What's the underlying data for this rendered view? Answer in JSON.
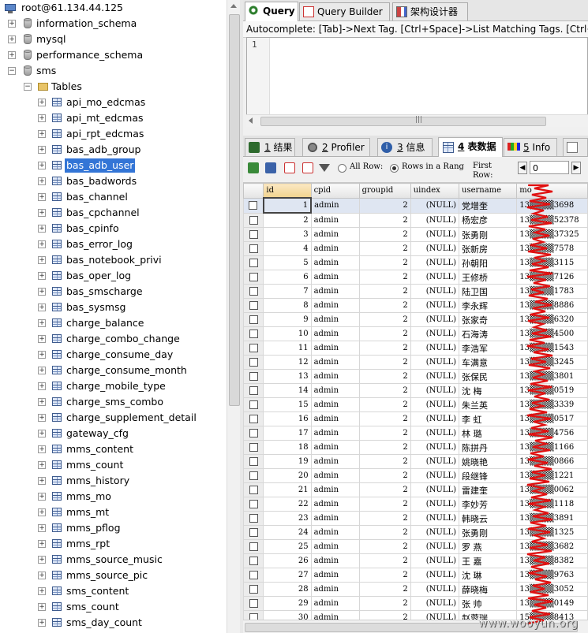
{
  "tree": {
    "connection": "root@61.134.44.125",
    "databases": [
      {
        "name": "information_schema",
        "expanded": false
      },
      {
        "name": "mysql",
        "expanded": false
      },
      {
        "name": "performance_schema",
        "expanded": false
      },
      {
        "name": "sms",
        "expanded": true
      }
    ],
    "tables_folder": "Tables",
    "tables": [
      "api_mo_edcmas",
      "api_mt_edcmas",
      "api_rpt_edcmas",
      "bas_adb_group",
      "bas_adb_user",
      "bas_badwords",
      "bas_channel",
      "bas_cpchannel",
      "bas_cpinfo",
      "bas_error_log",
      "bas_notebook_privi",
      "bas_oper_log",
      "bas_smscharge",
      "bas_sysmsg",
      "charge_balance",
      "charge_combo_change",
      "charge_consume_day",
      "charge_consume_month",
      "charge_mobile_type",
      "charge_sms_combo",
      "charge_supplement_detail",
      "gateway_cfg",
      "mms_content",
      "mms_count",
      "mms_history",
      "mms_mo",
      "mms_mt",
      "mms_pflog",
      "mms_rpt",
      "mms_source_music",
      "mms_source_pic",
      "sms_content",
      "sms_count",
      "sms_day_count"
    ],
    "selected_table": "bas_adb_user"
  },
  "top_tabs": [
    {
      "label": "Query",
      "active": true,
      "icon": "query-icon"
    },
    {
      "label": "Query Builder",
      "active": false,
      "icon": "query-builder-icon"
    },
    {
      "label": "架构设计器",
      "active": false,
      "icon": "schema-designer-icon"
    }
  ],
  "autocomplete": "Autocomplete: [Tab]->Next Tag. [Ctrl+Space]->List Matching Tags. [Ctrl+E",
  "editor": {
    "line_number": "1"
  },
  "bottom_tabs": [
    {
      "num": "1",
      "label": "结果",
      "icon": "result-icon"
    },
    {
      "num": "2",
      "label": "Profiler",
      "icon": "profiler-icon"
    },
    {
      "num": "3",
      "label": "信息",
      "icon": "info-icon"
    },
    {
      "num": "4",
      "label": "表数据",
      "icon": "table-data-icon",
      "active": true
    },
    {
      "num": "5",
      "label": "Info",
      "icon": "info2-icon"
    }
  ],
  "toolbar": {
    "all_row": "All Row:",
    "rows_in_range": "Rows in a Rang",
    "first_row_label_1": "First",
    "first_row_label_2": "Row:",
    "first_row_value": "0"
  },
  "grid": {
    "columns": [
      "id",
      "cpid",
      "groupid",
      "uindex",
      "username",
      "mo"
    ],
    "rows": [
      [
        "1",
        "admin",
        "2",
        "(NULL)",
        "党增奎",
        "13▒▒▒▒3698"
      ],
      [
        "2",
        "admin",
        "2",
        "(NULL)",
        "杨宏彦",
        "13▒▒▒▒52378"
      ],
      [
        "3",
        "admin",
        "2",
        "(NULL)",
        "张勇刚",
        "13▒▒▒▒37325"
      ],
      [
        "4",
        "admin",
        "2",
        "(NULL)",
        "张新房",
        "13▒▒▒▒7578"
      ],
      [
        "5",
        "admin",
        "2",
        "(NULL)",
        "孙朝阳",
        "13▒▒▒▒3115"
      ],
      [
        "6",
        "admin",
        "2",
        "(NULL)",
        "王修桥",
        "13▒▒▒▒7126"
      ],
      [
        "7",
        "admin",
        "2",
        "(NULL)",
        "陆卫国",
        "13▒▒▒▒1783"
      ],
      [
        "8",
        "admin",
        "2",
        "(NULL)",
        "李永辉",
        "13▒▒▒▒8886"
      ],
      [
        "9",
        "admin",
        "2",
        "(NULL)",
        "张家奇",
        "13▒▒▒▒6320"
      ],
      [
        "10",
        "admin",
        "2",
        "(NULL)",
        "石海涛",
        "13▒▒▒▒4500"
      ],
      [
        "11",
        "admin",
        "2",
        "(NULL)",
        "李浩军",
        "13▒▒▒▒1543"
      ],
      [
        "12",
        "admin",
        "2",
        "(NULL)",
        "车满意",
        "13▒▒▒▒3245"
      ],
      [
        "13",
        "admin",
        "2",
        "(NULL)",
        "张保民",
        "13▒▒▒▒3801"
      ],
      [
        "14",
        "admin",
        "2",
        "(NULL)",
        "沈 梅",
        "13▒▒▒▒0519"
      ],
      [
        "15",
        "admin",
        "2",
        "(NULL)",
        "朱兰英",
        "13▒▒▒▒3339"
      ],
      [
        "16",
        "admin",
        "2",
        "(NULL)",
        "李 虹",
        "13▒▒▒▒0517"
      ],
      [
        "17",
        "admin",
        "2",
        "(NULL)",
        "林 璐",
        "13▒▒▒▒4756"
      ],
      [
        "18",
        "admin",
        "2",
        "(NULL)",
        "陈拼丹",
        "13▒▒▒▒1166"
      ],
      [
        "19",
        "admin",
        "2",
        "(NULL)",
        "姚晓艳",
        "13▒▒▒▒0866"
      ],
      [
        "20",
        "admin",
        "2",
        "(NULL)",
        "段继锋",
        "13▒▒▒▒1221"
      ],
      [
        "21",
        "admin",
        "2",
        "(NULL)",
        "雷建奎",
        "13▒▒▒▒0062"
      ],
      [
        "22",
        "admin",
        "2",
        "(NULL)",
        "李妙芳",
        "13▒▒▒▒1118"
      ],
      [
        "23",
        "admin",
        "2",
        "(NULL)",
        "韩晓云",
        "13▒▒▒▒3891"
      ],
      [
        "24",
        "admin",
        "2",
        "(NULL)",
        "张勇刚",
        "13▒▒▒▒1325"
      ],
      [
        "25",
        "admin",
        "2",
        "(NULL)",
        "罗 燕",
        "13▒▒▒▒3682"
      ],
      [
        "26",
        "admin",
        "2",
        "(NULL)",
        "王 嘉",
        "13▒▒▒▒8382"
      ],
      [
        "27",
        "admin",
        "2",
        "(NULL)",
        "沈 琳",
        "13▒▒▒▒9763"
      ],
      [
        "28",
        "admin",
        "2",
        "(NULL)",
        "薛晓梅",
        "13▒▒▒▒3052"
      ],
      [
        "29",
        "admin",
        "2",
        "(NULL)",
        "张 帅",
        "13▒▒▒▒0149"
      ],
      [
        "30",
        "admin",
        "2",
        "(NULL)",
        "赵蓉瑞",
        "15▒▒▒▒8413"
      ]
    ]
  },
  "watermark": "www.wooyun.org",
  "colors": {
    "selection": "#3375d6",
    "redaction": "#e01010"
  }
}
